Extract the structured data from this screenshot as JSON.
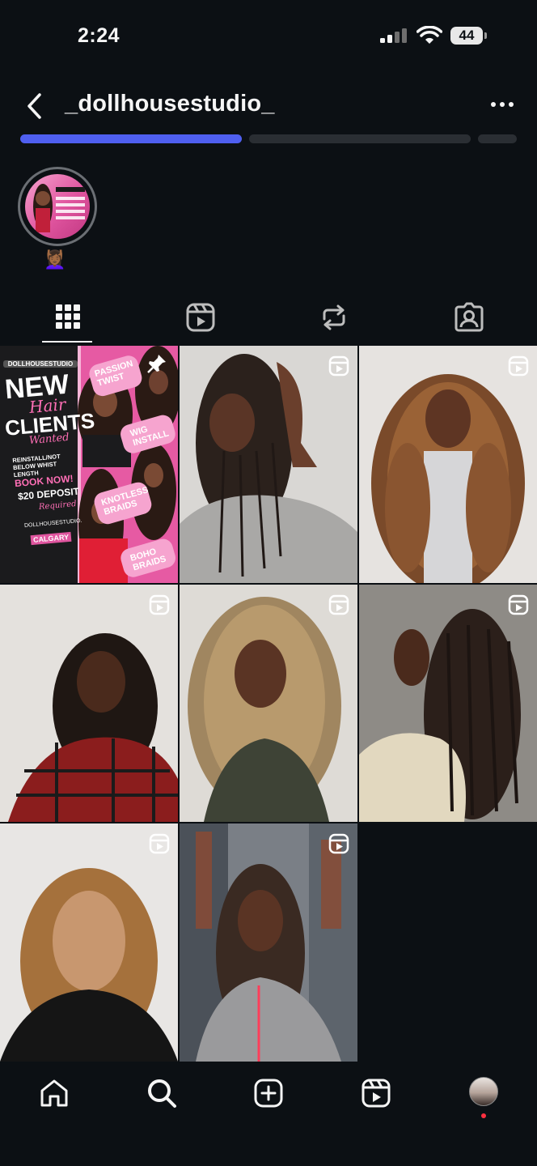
{
  "status_bar": {
    "time": "2:24",
    "battery": "44"
  },
  "header": {
    "title": "_dollhousestudio_",
    "back_icon": "chevron-left-icon",
    "more_icon": "more-horizontal-icon"
  },
  "highlight": {
    "label": "💆🏾‍♀️",
    "card_title": "DOLLHOUSESTUDIO",
    "card_lines": [
      "WIG INSTALL",
      "BOHO BRAIDS",
      "PASSION TWIST",
      "KNOTLESS BRAIDS"
    ]
  },
  "tabs": [
    {
      "name": "grid",
      "icon": "grid-icon",
      "active": true
    },
    {
      "name": "reels",
      "icon": "reels-icon",
      "active": false
    },
    {
      "name": "reposts",
      "icon": "repost-icon",
      "active": false
    },
    {
      "name": "tagged",
      "icon": "tagged-user-icon",
      "active": false
    }
  ],
  "promo_post": {
    "brand": "DOLLHOUSESTUDIO",
    "headline_1": "NEW",
    "headline_2": "Hair",
    "headline_3": "CLIENTS",
    "headline_4": "Wanted",
    "length_note": "REINSTALL/NOT BELOW WHIST LENGTH",
    "book_now": "BOOK NOW!",
    "deposit": "$20 DEPOSIT",
    "deposit_note": "Required",
    "handle": "DOLLHOUSESTUDIO.",
    "location": "CALGARY",
    "services": [
      "PASSION TWIST",
      "WIG INSTALL",
      "KNOTLESS BRAIDS",
      "BOHO BRAIDS"
    ]
  },
  "bottom_nav": [
    "home-icon",
    "search-icon",
    "create-post-icon",
    "reels-icon",
    "profile-avatar"
  ],
  "colors": {
    "background": "#0c1014",
    "accent_bar": "#4f5ff0",
    "pink": "#e0559f",
    "notification": "#ff3040"
  }
}
